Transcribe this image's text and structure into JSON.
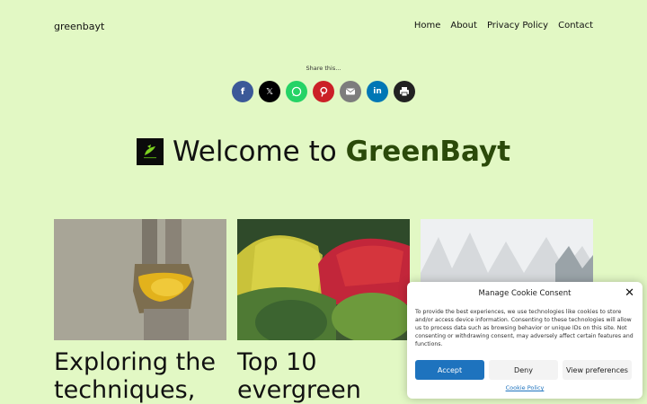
{
  "header": {
    "site_title": "greenbayt",
    "nav": [
      "Home",
      "About",
      "Privacy Policy",
      "Contact"
    ]
  },
  "share": {
    "label": "Share this...",
    "buttons": [
      {
        "name": "facebook",
        "icon": "facebook-icon",
        "glyph": "f",
        "color": "#3b5998"
      },
      {
        "name": "x",
        "icon": "x-icon",
        "glyph": "𝕏",
        "color": "#000000"
      },
      {
        "name": "whatsapp",
        "icon": "whatsapp-icon",
        "glyph": "",
        "color": "#25d366"
      },
      {
        "name": "pinterest",
        "icon": "pinterest-icon",
        "glyph": "",
        "color": "#cb2027"
      },
      {
        "name": "email",
        "icon": "email-icon",
        "glyph": "",
        "color": "#7d7d7d"
      },
      {
        "name": "linkedin",
        "icon": "linkedin-icon",
        "glyph": "in",
        "color": "#0077b5"
      },
      {
        "name": "print",
        "icon": "print-icon",
        "glyph": "",
        "color": "#222222"
      }
    ]
  },
  "hero": {
    "prefix": "Welcome to ",
    "brand": "GreenBayt",
    "brand_color": "#2b4a0a"
  },
  "cards": [
    {
      "title": "Exploring the techniques,"
    },
    {
      "title": "Top 10 evergreen"
    },
    {
      "title": ""
    }
  ],
  "cookie": {
    "title": "Manage Cookie Consent",
    "text": "To provide the best experiences, we use technologies like cookies to store and/or access device information. Consenting to these technologies will allow us to process data such as browsing behavior or unique IDs on this site. Not consenting or withdrawing consent, may adversely affect certain features and functions.",
    "accept": "Accept",
    "deny": "Deny",
    "preferences": "View preferences",
    "policy_link": "Cookie Policy",
    "accent": "#1e73be"
  }
}
